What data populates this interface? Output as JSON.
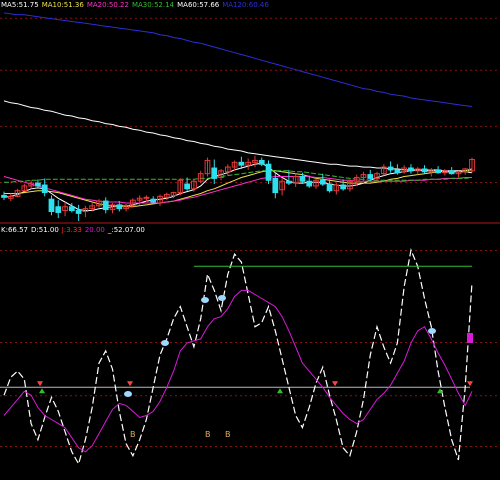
{
  "colors": {
    "background": "#000000",
    "grid_dash": "#8a1111",
    "divider": "#b01818",
    "ma_white": "#ffffff",
    "ma_yellow": "#f0e04a",
    "ma_magenta": "#ff2ecb",
    "ma_green": "#2fbf2f",
    "ma_blue": "#2d2dd6",
    "candle_up": "#e23a3a",
    "candle_down": "#2ee0ee",
    "kdj_white": "#ffffff",
    "kdj_magenta": "#d81bd8",
    "kdj_green": "#2fbf2f",
    "ref_line": "#b9b9b9"
  },
  "top_header": {
    "items": [
      {
        "text": "MA5:51.75",
        "color": "#ffffff"
      },
      {
        "text": "MA10:51.36",
        "color": "#f0e04a"
      },
      {
        "text": "MA20:50.22",
        "color": "#ff2ecb"
      },
      {
        "text": "MA30:52.14",
        "color": "#2fbf2f"
      },
      {
        "text": "MA60:57.66",
        "color": "#ffffff"
      },
      {
        "text": "MA120:60.46",
        "color": "#2d2dd6"
      }
    ]
  },
  "bottom_header": {
    "items": [
      {
        "text": "K:66.57",
        "color": "#ffffff"
      },
      {
        "text": "D:51.00",
        "color": "#ffffff"
      },
      {
        "text": "J:3.33",
        "color": "#ff2e2e"
      },
      {
        "text": "20.00",
        "color": "#d81bd8"
      },
      {
        "text": "_:52.07.00",
        "color": "#ffffff"
      }
    ]
  },
  "markers": {
    "b_labels": [
      "B",
      "B",
      "B"
    ]
  },
  "chart_data": [
    {
      "type": "candlestick",
      "title": "",
      "ylim": [
        46,
        68
      ],
      "grid": true,
      "candles": [
        [
          48.6,
          49.0,
          48.1,
          48.4
        ],
        [
          48.3,
          48.8,
          48.0,
          48.5
        ],
        [
          48.5,
          49.3,
          48.4,
          49.1
        ],
        [
          49.1,
          49.8,
          49.0,
          49.6
        ],
        [
          49.6,
          50.2,
          49.3,
          49.9
        ],
        [
          49.9,
          50.3,
          49.4,
          49.6
        ],
        [
          49.7,
          50.4,
          48.5,
          48.9
        ],
        [
          48.2,
          48.6,
          46.5,
          46.9
        ],
        [
          47.4,
          48.1,
          46.2,
          46.8
        ],
        [
          47.0,
          47.9,
          46.4,
          47.4
        ],
        [
          47.4,
          47.8,
          46.8,
          47.0
        ],
        [
          47.0,
          47.6,
          45.9,
          46.7
        ],
        [
          46.9,
          47.5,
          46.3,
          47.2
        ],
        [
          47.2,
          47.8,
          46.9,
          47.5
        ],
        [
          47.5,
          48.2,
          47.3,
          48.0
        ],
        [
          48.0,
          48.4,
          46.7,
          47.1
        ],
        [
          47.1,
          47.8,
          46.7,
          47.6
        ],
        [
          47.6,
          48.0,
          46.9,
          47.2
        ],
        [
          47.2,
          47.7,
          46.9,
          47.5
        ],
        [
          47.5,
          48.3,
          47.4,
          48.1
        ],
        [
          48.1,
          48.6,
          47.6,
          48.3
        ],
        [
          48.3,
          48.6,
          47.9,
          48.4
        ],
        [
          48.2,
          48.5,
          47.7,
          47.9
        ],
        [
          47.8,
          48.7,
          47.5,
          48.5
        ],
        [
          48.4,
          48.9,
          48.1,
          48.7
        ],
        [
          48.6,
          49.0,
          48.3,
          48.9
        ],
        [
          48.9,
          50.4,
          48.6,
          50.2
        ],
        [
          49.8,
          50.5,
          49.1,
          49.3
        ],
        [
          49.3,
          50.3,
          49.0,
          50.1
        ],
        [
          50.1,
          51.2,
          49.9,
          50.9
        ],
        [
          50.9,
          52.6,
          50.6,
          52.3
        ],
        [
          51.5,
          52.4,
          49.8,
          50.4
        ],
        [
          50.5,
          51.4,
          50.2,
          51.2
        ],
        [
          51.1,
          51.9,
          50.7,
          51.6
        ],
        [
          51.6,
          52.3,
          51.2,
          52.1
        ],
        [
          52.1,
          52.7,
          51.4,
          51.8
        ],
        [
          51.8,
          52.5,
          51.3,
          52.1
        ],
        [
          52.1,
          52.8,
          51.6,
          52.3
        ],
        [
          52.3,
          52.6,
          51.7,
          51.9
        ],
        [
          51.9,
          52.3,
          49.8,
          50.2
        ],
        [
          50.4,
          51.0,
          48.3,
          48.9
        ],
        [
          49.2,
          50.4,
          48.6,
          50.1
        ],
        [
          50.1,
          51.3,
          49.7,
          49.9
        ],
        [
          49.9,
          50.9,
          49.5,
          50.6
        ],
        [
          50.6,
          51.0,
          49.8,
          50.1
        ],
        [
          50.1,
          50.7,
          49.4,
          49.6
        ],
        [
          49.6,
          50.4,
          49.3,
          50.2
        ],
        [
          50.2,
          50.9,
          49.6,
          49.8
        ],
        [
          49.8,
          50.3,
          48.9,
          49.1
        ],
        [
          49.1,
          49.9,
          48.7,
          49.7
        ],
        [
          49.7,
          50.3,
          49.1,
          49.3
        ],
        [
          49.3,
          50.3,
          49.0,
          50.1
        ],
        [
          50.1,
          50.8,
          49.6,
          50.5
        ],
        [
          50.5,
          51.1,
          50.1,
          50.8
        ],
        [
          50.8,
          51.3,
          50.1,
          50.4
        ],
        [
          50.4,
          51.1,
          50.0,
          50.9
        ],
        [
          50.9,
          51.9,
          50.7,
          51.6
        ],
        [
          51.6,
          52.2,
          51.0,
          51.3
        ],
        [
          51.3,
          51.9,
          50.8,
          51.0
        ],
        [
          51.1,
          51.8,
          50.9,
          51.5
        ],
        [
          51.5,
          51.9,
          50.9,
          51.2
        ],
        [
          51.2,
          51.6,
          50.8,
          51.4
        ],
        [
          51.4,
          51.8,
          50.9,
          51.1
        ],
        [
          51.1,
          51.5,
          50.6,
          51.3
        ],
        [
          51.3,
          51.7,
          50.9,
          51.0
        ],
        [
          51.0,
          51.4,
          50.7,
          51.2
        ],
        [
          51.2,
          51.6,
          50.8,
          50.9
        ],
        [
          50.9,
          51.2,
          50.5,
          51.1
        ],
        [
          51.1,
          51.5,
          50.8,
          51.4
        ],
        [
          51.2,
          52.6,
          51.0,
          52.4
        ]
      ],
      "series": [
        {
          "name": "MA5",
          "color": "#ffffff",
          "values": [
            48.4,
            48.5,
            48.7,
            49.0,
            49.3,
            49.4,
            49.3,
            48.8,
            48.3,
            47.9,
            47.5,
            47.1,
            47.0,
            47.0,
            47.2,
            47.3,
            47.4,
            47.5,
            47.5,
            47.6,
            47.8,
            48.0,
            48.1,
            48.2,
            48.3,
            48.5,
            48.8,
            49.0,
            49.2,
            49.6,
            50.3,
            50.6,
            50.8,
            51.0,
            51.3,
            51.5,
            51.7,
            51.9,
            52.0,
            51.6,
            51.0,
            50.5,
            50.1,
            49.9,
            49.9,
            50.0,
            50.0,
            50.0,
            49.8,
            49.7,
            49.6,
            49.6,
            49.7,
            49.9,
            50.2,
            50.5,
            50.7,
            50.9,
            51.0,
            51.1,
            51.2,
            51.3,
            51.3,
            51.3,
            51.3,
            51.2,
            51.2,
            51.2,
            51.2,
            51.4
          ]
        },
        {
          "name": "MA10",
          "color": "#f0e04a",
          "values": [
            48.8,
            48.8,
            48.8,
            48.9,
            49.0,
            49.1,
            49.1,
            49.0,
            48.9,
            48.7,
            48.5,
            48.3,
            48.1,
            47.9,
            47.7,
            47.6,
            47.5,
            47.5,
            47.4,
            47.4,
            47.5,
            47.6,
            47.7,
            47.8,
            47.9,
            48.0,
            48.2,
            48.4,
            48.6,
            48.8,
            49.1,
            49.3,
            49.6,
            49.9,
            50.2,
            50.5,
            50.7,
            50.9,
            51.1,
            51.2,
            51.2,
            51.1,
            51.0,
            50.9,
            50.8,
            50.6,
            50.4,
            50.3,
            50.2,
            50.1,
            50.0,
            49.9,
            49.9,
            49.9,
            49.9,
            50.0,
            50.1,
            50.3,
            50.4,
            50.6,
            50.7,
            50.8,
            50.9,
            51.0,
            51.1,
            51.1,
            51.1,
            51.1,
            51.2,
            51.2
          ]
        },
        {
          "name": "MA20",
          "color": "#ff2ecb",
          "values": [
            50.6,
            50.4,
            50.2,
            50.0,
            49.8,
            49.6,
            49.4,
            49.2,
            49.0,
            48.8,
            48.6,
            48.4,
            48.2,
            48.1,
            48.0,
            47.9,
            47.9,
            47.9,
            47.8,
            47.8,
            47.8,
            47.8,
            47.8,
            47.8,
            47.9,
            48.0,
            48.1,
            48.3,
            48.4,
            48.6,
            48.8,
            49.0,
            49.2,
            49.4,
            49.6,
            49.8,
            50.0,
            50.2,
            50.4,
            50.5,
            50.6,
            50.6,
            50.6,
            50.6,
            50.6,
            50.6,
            50.5,
            50.5,
            50.4,
            50.3,
            50.2,
            50.2,
            50.1,
            50.1,
            50.1,
            50.1,
            50.1,
            50.1,
            50.1,
            50.1,
            50.2,
            50.2,
            50.2,
            50.3,
            50.3,
            50.4,
            50.4,
            50.4,
            50.5,
            50.5
          ]
        },
        {
          "name": "MA30",
          "color": "#2fbf2f",
          "values": [
            50.0,
            50.0,
            50.1,
            50.1,
            50.2,
            50.2,
            50.3,
            50.3,
            50.3,
            50.3,
            50.3,
            50.3,
            50.3,
            50.3,
            50.3,
            50.3,
            50.3,
            50.3,
            50.3,
            50.3,
            50.3,
            50.3,
            50.3,
            50.3,
            50.3,
            50.3,
            50.3,
            50.3,
            50.3,
            50.4,
            50.4,
            50.5,
            50.6,
            50.7,
            50.8,
            50.9,
            51.0,
            51.1,
            51.2,
            51.2,
            51.2,
            51.2,
            51.2,
            51.1,
            51.1,
            51.0,
            50.9,
            50.8,
            50.7,
            50.6,
            50.5,
            50.4,
            50.3,
            50.3,
            50.2,
            50.2,
            50.2,
            50.2,
            50.2,
            50.2,
            50.2,
            50.2,
            50.3,
            50.3,
            50.3,
            50.3,
            50.4,
            50.4,
            50.4,
            50.5
          ]
        },
        {
          "name": "MA60",
          "color": "#ffffff",
          "values": [
            58.6,
            58.4,
            58.3,
            58.1,
            57.9,
            57.8,
            57.6,
            57.5,
            57.3,
            57.1,
            57.0,
            56.8,
            56.7,
            56.5,
            56.4,
            56.2,
            56.1,
            55.9,
            55.8,
            55.6,
            55.5,
            55.3,
            55.2,
            55.0,
            54.9,
            54.7,
            54.6,
            54.4,
            54.3,
            54.1,
            54.0,
            53.8,
            53.7,
            53.5,
            53.4,
            53.3,
            53.1,
            53.0,
            52.9,
            52.8,
            52.7,
            52.6,
            52.5,
            52.4,
            52.3,
            52.2,
            52.1,
            52.0,
            51.9,
            51.9,
            51.8,
            51.7,
            51.7,
            51.6,
            51.6,
            51.5,
            51.5,
            51.4,
            51.4,
            51.3,
            51.3,
            51.3,
            51.2,
            51.2,
            51.2,
            51.1,
            51.1,
            51.1,
            51.1,
            51.0
          ]
        },
        {
          "name": "MA120",
          "color": "#2d2dd6",
          "values": [
            67.9,
            67.8,
            67.7,
            67.7,
            67.6,
            67.5,
            67.4,
            67.3,
            67.2,
            67.1,
            67.0,
            66.9,
            66.8,
            66.7,
            66.6,
            66.5,
            66.4,
            66.3,
            66.2,
            66.1,
            66.0,
            65.9,
            65.8,
            65.6,
            65.5,
            65.3,
            65.2,
            65.0,
            64.8,
            64.7,
            64.5,
            64.3,
            64.1,
            63.9,
            63.7,
            63.5,
            63.3,
            63.1,
            62.9,
            62.7,
            62.5,
            62.3,
            62.1,
            61.9,
            61.7,
            61.5,
            61.3,
            61.1,
            60.9,
            60.7,
            60.5,
            60.3,
            60.1,
            59.9,
            59.8,
            59.6,
            59.5,
            59.3,
            59.2,
            59.1,
            58.9,
            58.8,
            58.7,
            58.6,
            58.5,
            58.4,
            58.3,
            58.2,
            58.1,
            58.0
          ]
        }
      ]
    },
    {
      "type": "line",
      "title": "",
      "ylim": [
        -5,
        115
      ],
      "grid": true,
      "reference_line": 40,
      "series": [
        {
          "name": "K",
          "color": "#ffffff",
          "values": [
            36,
            45,
            48,
            44,
            22,
            14,
            25,
            35,
            28,
            18,
            8,
            2,
            14,
            30,
            52,
            58,
            49,
            28,
            12,
            6,
            14,
            24,
            40,
            56,
            64,
            74,
            80,
            70,
            60,
            74,
            96,
            88,
            78,
            96,
            106,
            102,
            86,
            70,
            72,
            80,
            68,
            54,
            40,
            26,
            20,
            30,
            42,
            50,
            36,
            24,
            10,
            6,
            18,
            34,
            56,
            70,
            60,
            52,
            62,
            90,
            108,
            100,
            84,
            70,
            48,
            30,
            14,
            4,
            40,
            92
          ]
        },
        {
          "name": "D",
          "color": "#d81bd8",
          "values": [
            26,
            30,
            34,
            38,
            36,
            30,
            26,
            24,
            22,
            20,
            15,
            10,
            8,
            11,
            17,
            23,
            29,
            32,
            31,
            28,
            25,
            26,
            28,
            33,
            40,
            48,
            58,
            62,
            63,
            64,
            70,
            74,
            75,
            79,
            85,
            88,
            88,
            86,
            84,
            82,
            80,
            75,
            68,
            60,
            52,
            48,
            44,
            40,
            35,
            31,
            27,
            24,
            22,
            24,
            29,
            34,
            37,
            41,
            47,
            53,
            62,
            68,
            70,
            64,
            57,
            51,
            44,
            37,
            31,
            38
          ]
        },
        {
          "name": "J",
          "color": "#2fbf2f",
          "values": [
            null,
            null,
            null,
            null,
            null,
            null,
            null,
            null,
            null,
            null,
            null,
            null,
            null,
            null,
            null,
            null,
            null,
            null,
            null,
            null,
            null,
            null,
            null,
            null,
            null,
            null,
            null,
            null,
            100,
            100,
            100,
            100,
            100,
            100,
            100,
            100,
            100,
            100,
            100,
            100,
            100,
            100,
            100,
            100,
            100,
            100,
            100,
            100,
            100,
            100,
            100,
            100,
            100,
            100,
            100,
            100,
            100,
            100,
            100,
            100,
            100,
            100,
            100,
            100,
            100,
            100,
            100,
            100,
            100,
            100
          ]
        }
      ]
    }
  ]
}
